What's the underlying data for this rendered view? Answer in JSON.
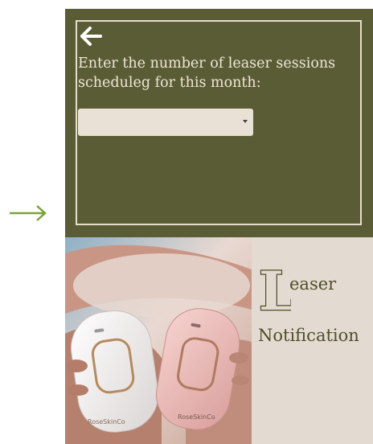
{
  "indicator": {
    "icon": "right-arrow-icon",
    "color": "#7aa33a"
  },
  "panel": {
    "background": "#5a5c36",
    "back_icon": "left-arrow-icon",
    "prompt": "Enter the number of leaser sessions scheduleg for this month:",
    "select": {
      "value": ""
    }
  },
  "photo": {
    "brand_label_left": "RoseSkinCo",
    "brand_label_right": "RoseSkinCo"
  },
  "title": {
    "drop_cap": "L",
    "word_rest": "easer",
    "line2": "Notification",
    "color": "#4e4e2a",
    "background": "#e3dbd1"
  }
}
